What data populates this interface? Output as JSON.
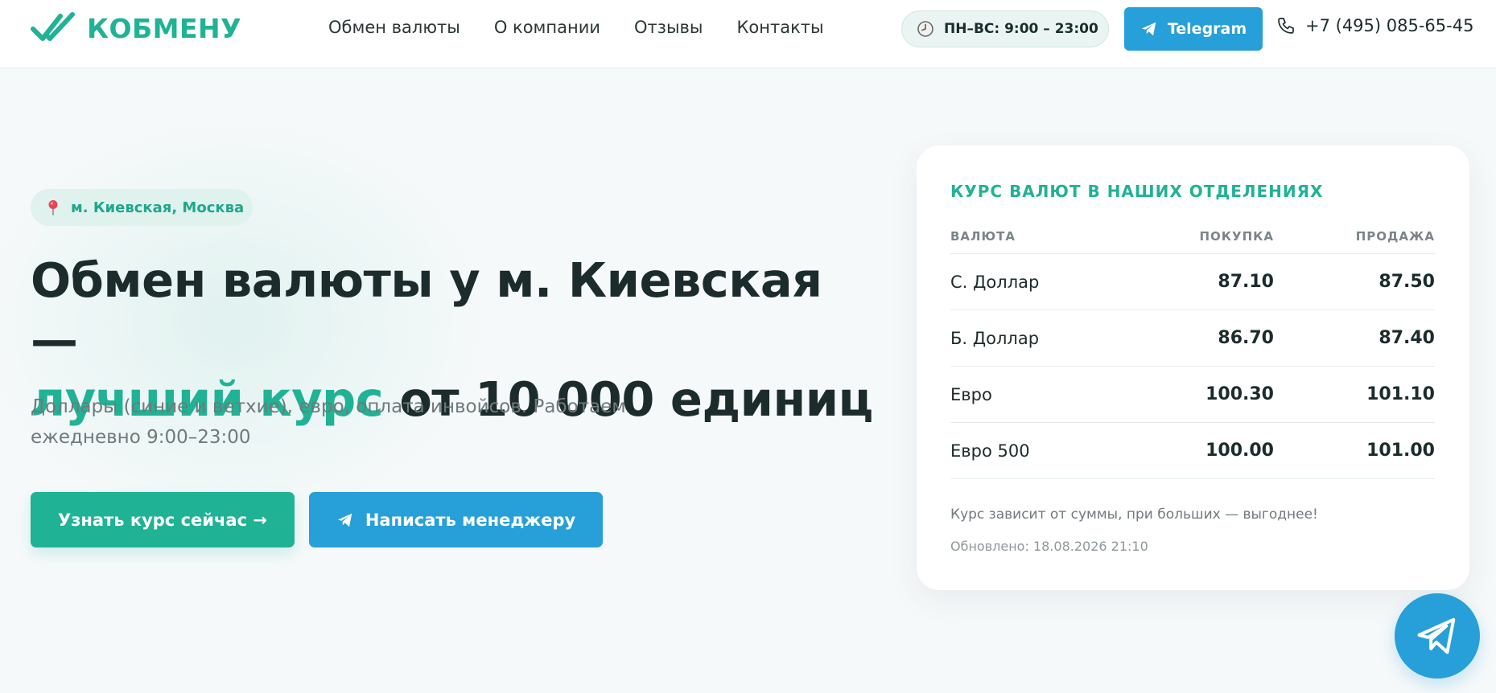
{
  "header": {
    "logo_text": "КОБМЕНУ",
    "nav": [
      "Обмен валюты",
      "О компании",
      "Отзывы",
      "Контакты"
    ],
    "hours": "ПН–ВС: 9:00 – 23:00",
    "telegram_label": "Telegram",
    "phone": "+7 (495) 085-65-45"
  },
  "hero": {
    "location": "м. Киевская, Москва",
    "title_line1": "Обмен валюты у м. Киевская —",
    "title_accent": "лучший курс",
    "title_rest": " от 10 000 единиц",
    "subtitle": "Доллары (синие и ветхие), евро, оплата инвойсов. Работаем ежедневно 9:00–23:00",
    "primary_button": "Узнать курс сейчас →",
    "secondary_button": "Написать менеджеру"
  },
  "rates_card": {
    "title": "КУРС ВАЛЮТ В НАШИХ ОТДЕЛЕНИЯХ",
    "headers": {
      "currency": "ВАЛЮТА",
      "buy": "ПОКУПКА",
      "sell": "ПРОДАЖА"
    },
    "rows": [
      {
        "currency": "С. Доллар",
        "buy": "87.10",
        "sell": "87.50"
      },
      {
        "currency": "Б. Доллар",
        "buy": "86.70",
        "sell": "87.40"
      },
      {
        "currency": "Евро",
        "buy": "100.30",
        "sell": "101.10"
      },
      {
        "currency": "Евро 500",
        "buy": "100.00",
        "sell": "101.00"
      }
    ],
    "note": "Курс зависит от суммы, при больших — выгоднее!",
    "updated": "Обновлено: 18.08.2026 21:10"
  },
  "colors": {
    "accent": "#20b294",
    "telegram": "#279fd8",
    "text": "#1c2b2b"
  },
  "icons": [
    "double-check-logo-icon",
    "clock-icon",
    "telegram-plane-icon",
    "phone-icon",
    "map-pin-icon"
  ]
}
